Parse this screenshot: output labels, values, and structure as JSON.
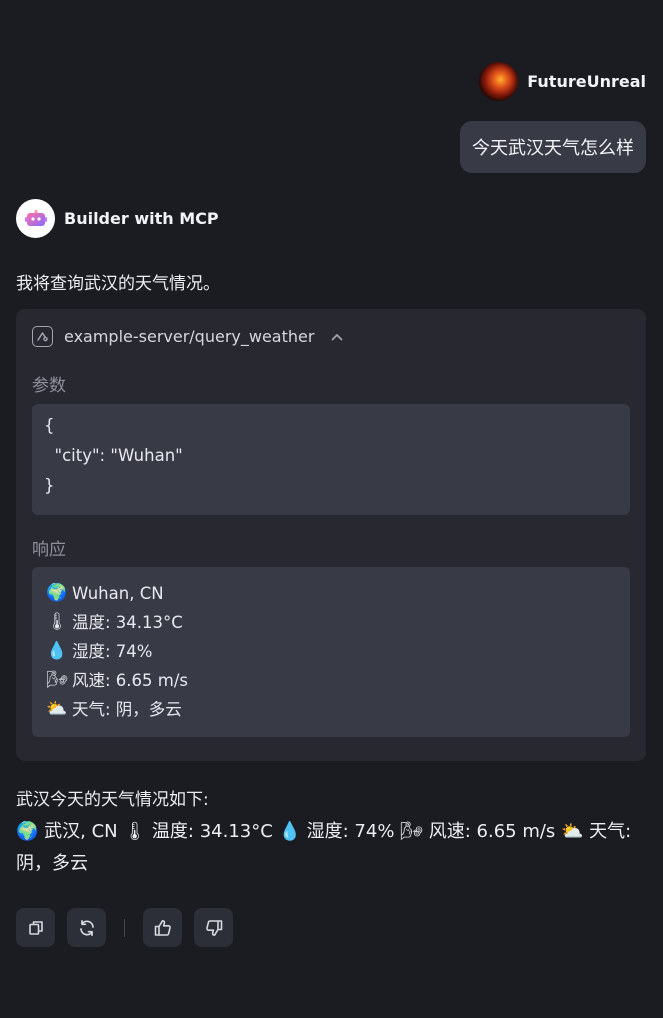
{
  "user": {
    "name": "FutureUnreal",
    "message": "今天武汉天气怎么样"
  },
  "assistant": {
    "name": "Builder with MCP",
    "intro": "我将查询武汉的天气情况。",
    "tool_call": {
      "name": "example-server/query_weather",
      "params_label": "参数",
      "params_lines": [
        "{",
        "  \"city\": \"Wuhan\"",
        "}"
      ],
      "response_label": "响应",
      "response_lines": [
        {
          "icon": "globe-icon",
          "emoji": "🌍",
          "text": "Wuhan, CN"
        },
        {
          "icon": "thermometer-icon",
          "emoji": "🌡",
          "text": "温度: 34.13°C"
        },
        {
          "icon": "droplet-icon",
          "emoji": "💧",
          "text": "湿度: 74%"
        },
        {
          "icon": "wind-icon",
          "emoji": "🌬",
          "text": "风速: 6.65 m/s"
        },
        {
          "icon": "sun-cloud-icon",
          "emoji": "⛅",
          "text": "天气: 阴，多云"
        }
      ]
    },
    "summary_title": "武汉今天的天气情况如下:",
    "summary_body": "🌍 武汉, CN 🌡 温度: 34.13°C 💧 湿度: 74% 🌬 风速: 6.65 m/s ⛅ 天气: 阴，多云"
  },
  "actions": [
    {
      "icon": "copy-icon"
    },
    {
      "icon": "refresh-icon"
    },
    {
      "icon": "thumbs-up-icon"
    },
    {
      "icon": "thumbs-down-icon"
    }
  ]
}
